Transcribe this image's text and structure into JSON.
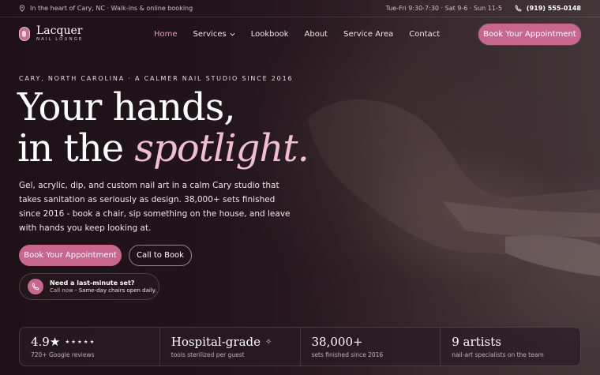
{
  "topbar": {
    "location": "In the heart of Cary, NC · Walk-ins & online booking",
    "hours": "Tue-Fri 9:30-7:30 · Sat 9-6 · Sun 11-5",
    "phone": "(919) 555-0148"
  },
  "brand": {
    "name": "Lacquer",
    "tagline": "NAIL LOUNGE"
  },
  "nav": {
    "items": [
      "Home",
      "Services",
      "Lookbook",
      "About",
      "Service Area",
      "Contact"
    ],
    "active": "Home",
    "cta": "Book Your Appointment"
  },
  "hero": {
    "eyebrow": "CARY, NORTH CAROLINA · A CALMER NAIL STUDIO SINCE 2016",
    "headline_line1": "Your hands,",
    "headline_line2_prefix": "in the ",
    "headline_accent": "spotlight.",
    "description": "Gel, acrylic, dip, and custom nail art in a calm Cary studio that takes sanitation as seriously as design. 38,000+ sets finished since 2016 - book a chair, sip something on the house, and leave with hands you keep looking at.",
    "primary_cta": "Book Your Appointment",
    "secondary_cta": "Call to Book",
    "callout_title": "Need a last-minute set?",
    "callout_lead": "Call now",
    "callout_rest": " - Same-day chairs open daily."
  },
  "stats": [
    {
      "value": "4.9★",
      "stars": "★★★★★",
      "label": "720+ Google reviews"
    },
    {
      "value": "Hospital-grade",
      "label": "tools sterilized per guest"
    },
    {
      "value": "38,000+",
      "label": "sets finished since 2016"
    },
    {
      "value": "9 artists",
      "label": "nail-art specialists on the team"
    }
  ],
  "colors": {
    "accent": "#c7668f",
    "accent_light": "#f0bdd3",
    "background": "#1f1419"
  },
  "icons": {
    "location": "map-pin-icon",
    "phone": "phone-icon",
    "sparkle": "sparkle-icon"
  }
}
